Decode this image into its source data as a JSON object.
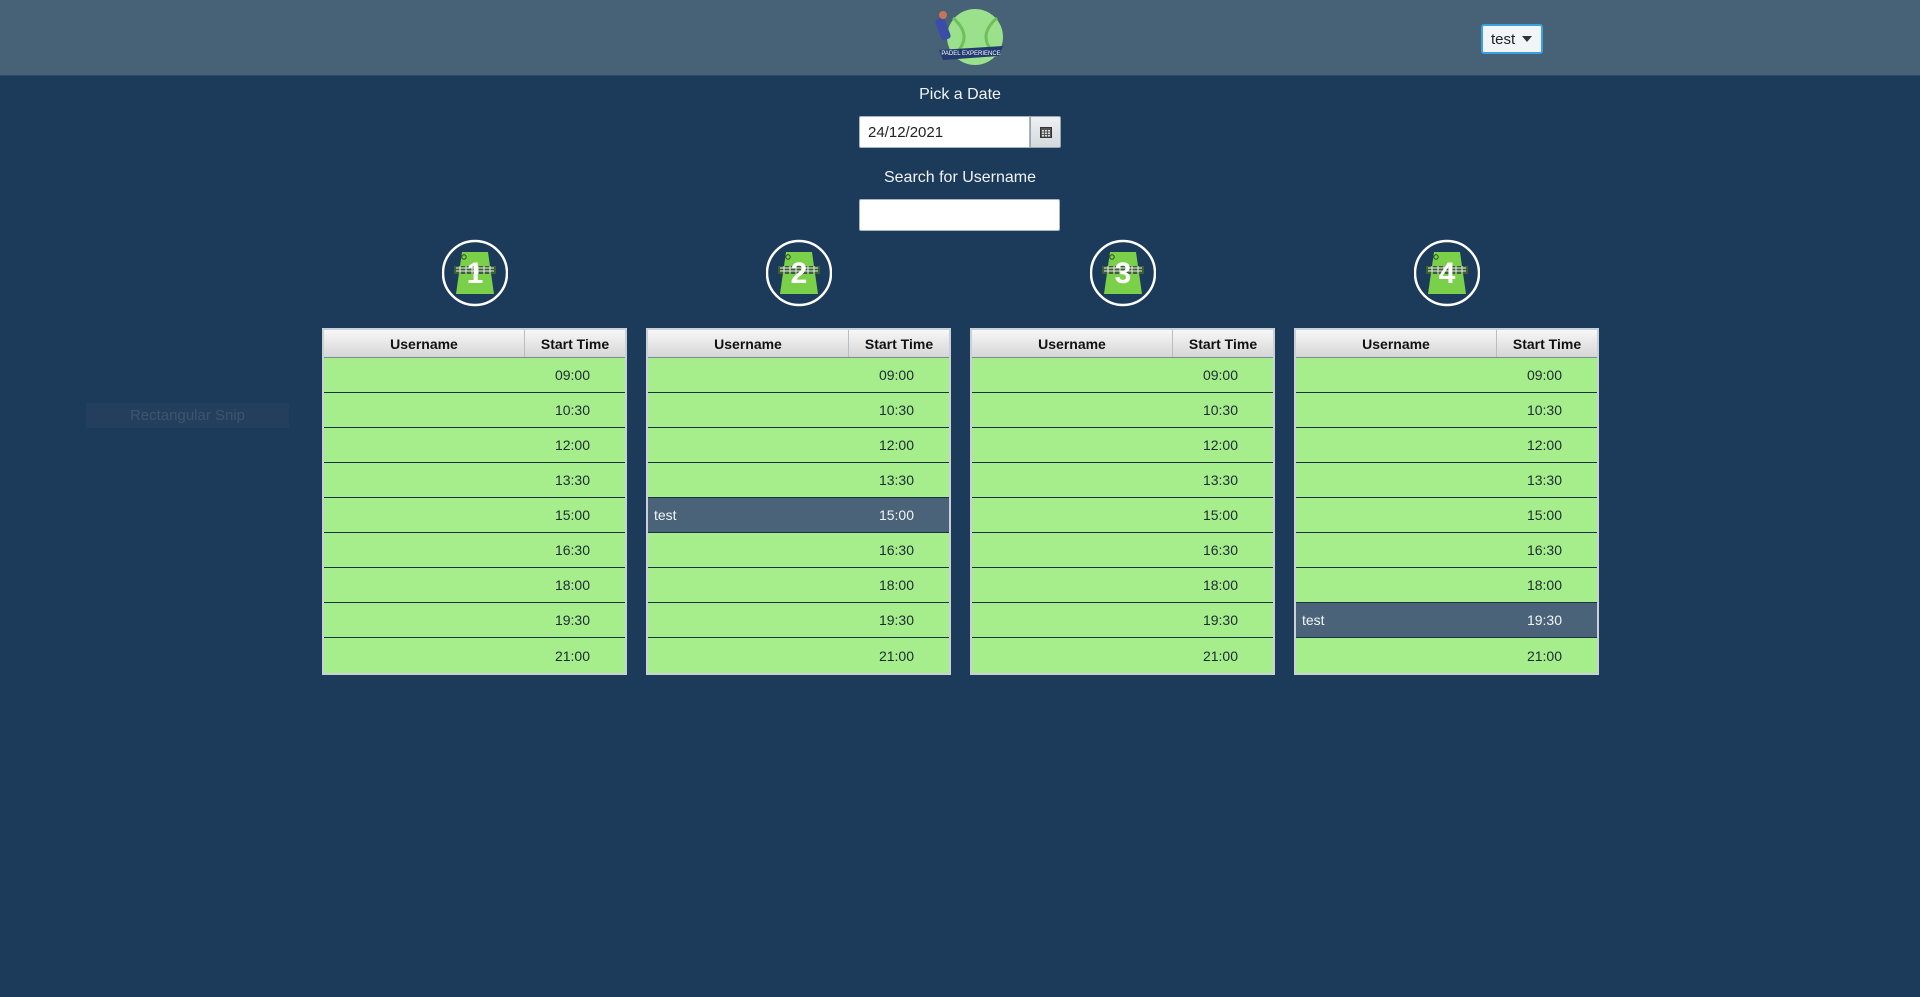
{
  "header": {
    "logo_text": "PADEL EXPERIENCE",
    "user_menu_label": "test"
  },
  "date_picker": {
    "label": "Pick a Date",
    "value": "24/12/2021",
    "button_icon": "calendar-icon"
  },
  "search": {
    "label": "Search for Username",
    "value": ""
  },
  "overlay": {
    "snip_text": "Rectangular Snip"
  },
  "table_headers": {
    "username": "Username",
    "start_time": "Start Time"
  },
  "courts": [
    {
      "number": "1",
      "rows": [
        {
          "username": "",
          "time": "09:00"
        },
        {
          "username": "",
          "time": "10:30"
        },
        {
          "username": "",
          "time": "12:00"
        },
        {
          "username": "",
          "time": "13:30"
        },
        {
          "username": "",
          "time": "15:00"
        },
        {
          "username": "",
          "time": "16:30"
        },
        {
          "username": "",
          "time": "18:00"
        },
        {
          "username": "",
          "time": "19:30"
        },
        {
          "username": "",
          "time": "21:00"
        }
      ]
    },
    {
      "number": "2",
      "rows": [
        {
          "username": "",
          "time": "09:00"
        },
        {
          "username": "",
          "time": "10:30"
        },
        {
          "username": "",
          "time": "12:00"
        },
        {
          "username": "",
          "time": "13:30"
        },
        {
          "username": "test",
          "time": "15:00"
        },
        {
          "username": "",
          "time": "16:30"
        },
        {
          "username": "",
          "time": "18:00"
        },
        {
          "username": "",
          "time": "19:30"
        },
        {
          "username": "",
          "time": "21:00"
        }
      ]
    },
    {
      "number": "3",
      "rows": [
        {
          "username": "",
          "time": "09:00"
        },
        {
          "username": "",
          "time": "10:30"
        },
        {
          "username": "",
          "time": "12:00"
        },
        {
          "username": "",
          "time": "13:30"
        },
        {
          "username": "",
          "time": "15:00"
        },
        {
          "username": "",
          "time": "16:30"
        },
        {
          "username": "",
          "time": "18:00"
        },
        {
          "username": "",
          "time": "19:30"
        },
        {
          "username": "",
          "time": "21:00"
        }
      ]
    },
    {
      "number": "4",
      "rows": [
        {
          "username": "",
          "time": "09:00"
        },
        {
          "username": "",
          "time": "10:30"
        },
        {
          "username": "",
          "time": "12:00"
        },
        {
          "username": "",
          "time": "13:30"
        },
        {
          "username": "",
          "time": "15:00"
        },
        {
          "username": "",
          "time": "16:30"
        },
        {
          "username": "",
          "time": "18:00"
        },
        {
          "username": "test",
          "time": "19:30"
        },
        {
          "username": "",
          "time": "21:00"
        }
      ]
    }
  ],
  "colors": {
    "background": "#1c3a5a",
    "header": "#476277",
    "free_slot": "#a6ee8c",
    "booked_slot": "#4a6378",
    "court_green": "#7bd04a"
  }
}
